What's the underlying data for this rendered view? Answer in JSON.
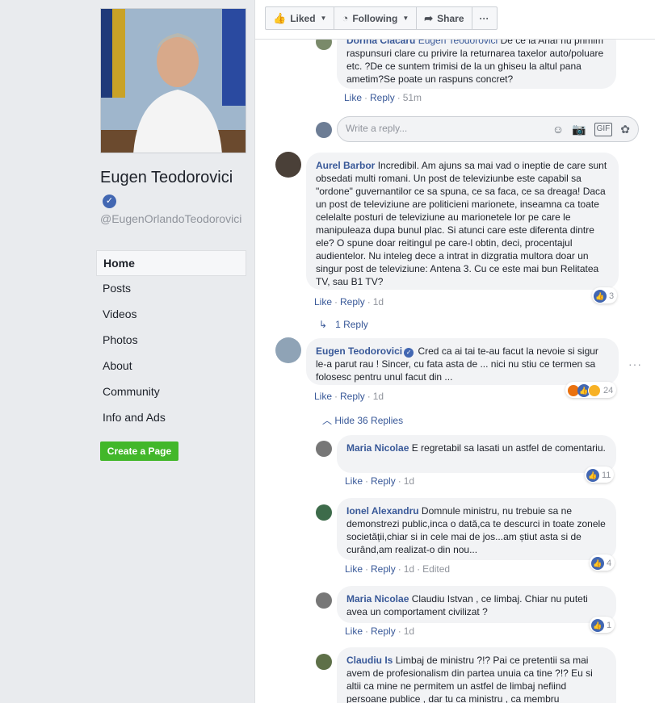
{
  "sidebar": {
    "page_name": "Eugen Teodorovici",
    "handle": "@EugenOrlandoTeodorovici",
    "nav": [
      "Home",
      "Posts",
      "Videos",
      "Photos",
      "About",
      "Community",
      "Info and Ads"
    ],
    "create_page": "Create a Page"
  },
  "topbar": {
    "liked": "Liked",
    "following": "Following",
    "share": "Share",
    "more": "···"
  },
  "reply_box": {
    "placeholder": "Write a reply..."
  },
  "comments": [
    {
      "author": "Dorina Ciacaru",
      "mention": "Eugen Teodorovici",
      "text": "De ce la Anaf nu primim raspunsuri clare cu privire la returnarea taxelor auto/poluare etc. ?De ce suntem trimisi de la un ghiseu la altul pana ametim?Se poate un raspuns concret?",
      "like": "Like",
      "reply": "Reply",
      "time": "51m"
    },
    {
      "author": "Aurel Barbor",
      "text": "Incredibil. Am ajuns sa mai vad o ineptie de care sunt obsedati multi romani. Un post de televiziunbe este capabil sa \"ordone\" guvernantilor ce sa spuna, ce sa faca, ce sa dreaga! Daca un post de televiziune are politicieni marionete, inseamna ca toate celelalte posturi de televiziune au marionetele lor pe care le manipuleaza dupa bunul plac. Si atunci care este diferenta dintre ele? O spune doar reitingul pe care-l obtin, deci, procentajul audientelor. Nu inteleg dece a intrat in dizgratia multora doar un singur post de televiziune: Antena 3. Cu ce este mai bun Relitatea TV, sau B1 TV?",
      "like": "Like",
      "reply": "Reply",
      "time": "1d",
      "reaction_count": "3",
      "replies_link": "1 Reply"
    },
    {
      "author": "Eugen Teodorovici",
      "text": "Cred ca ai tai te-au facut la nevoie si sigur le-a parut rau ! Sincer, cu fata asta de ... nici nu stiu ce termen sa folosesc pentru unul facut din ...",
      "like": "Like",
      "reply": "Reply",
      "time": "1d",
      "reaction_count": "24",
      "hide_link": "Hide 36 Replies"
    },
    {
      "author": "Maria Nicolae",
      "text": "E regretabil sa lasati un astfel de comentariu.",
      "like": "Like",
      "reply": "Reply",
      "time": "1d",
      "reaction_count": "11"
    },
    {
      "author": "Ionel Alexandru",
      "text": "Domnule ministru, nu trebuie sa ne demonstrezi public,inca o dată,ca te descurci in toate zonele societății,chiar si in cele mai de jos...am știut asta si de curând,am realizat-o din nou...",
      "like": "Like",
      "reply": "Reply",
      "time": "1d",
      "edited": "Edited",
      "reaction_count": "4"
    },
    {
      "author": "Maria Nicolae",
      "text": "Claudiu Istvan , ce limbaj. Chiar nu puteti avea un comportament civilizat ?",
      "like": "Like",
      "reply": "Reply",
      "time": "1d",
      "reaction_count": "1"
    },
    {
      "author": "Claudiu Is",
      "text": "Limbaj de ministru ?!? Pai ce pretentii sa mai avem de profesionalism din partea unuia ca tine ?!? Eu si altii ca mine ne permitem un astfel de limbaj nefiind persoane publice , dar tu ca ministru , ca membru"
    }
  ],
  "colors": {
    "link": "#385898",
    "like_blue": "#4267b2",
    "green": "#42b72a"
  }
}
